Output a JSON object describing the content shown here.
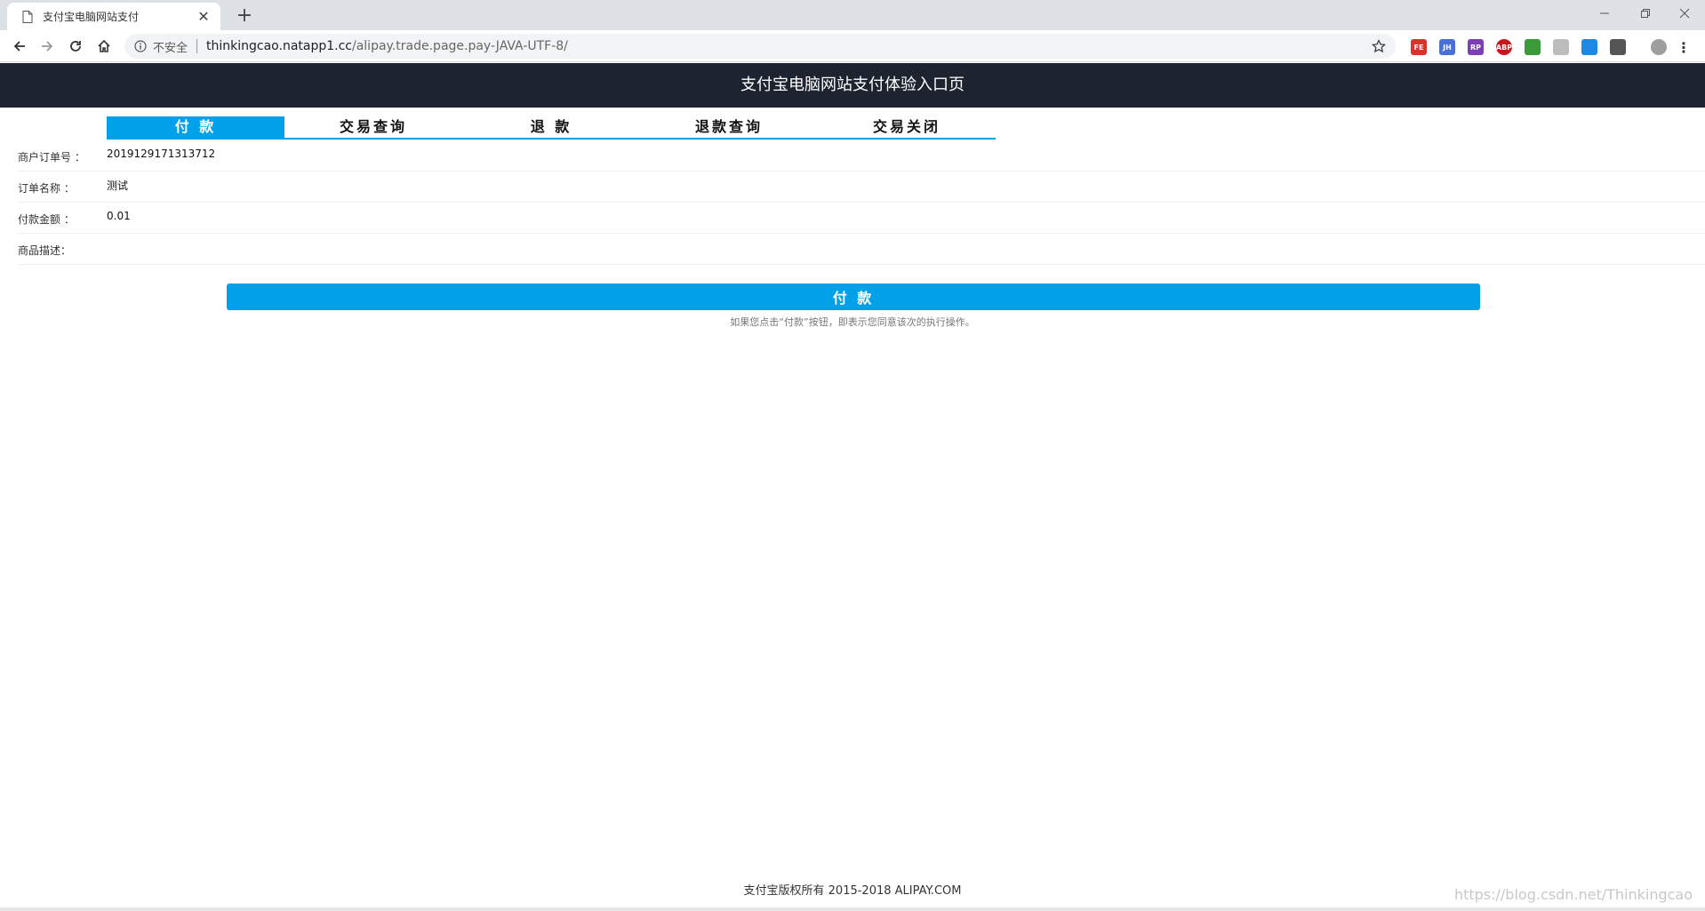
{
  "browser": {
    "tab_title": "支付宝电脑网站支付",
    "security_label": "不安全",
    "url_host": "thinkingcao.natapp1.cc",
    "url_path": "/alipay.trade.page.pay-JAVA-UTF-8/",
    "extensions": [
      {
        "icon": "fe-extension-icon",
        "label": "FE",
        "color": "#d9342b"
      },
      {
        "icon": "jh-extension-icon",
        "label": "JH",
        "color": "#4a6fd6"
      },
      {
        "icon": "rp-extension-icon",
        "label": "RP",
        "color": "#7b3fb5"
      },
      {
        "icon": "adblock-plus-icon",
        "label": "ABP",
        "color": "#c4161c"
      },
      {
        "icon": "google-extension-icon",
        "label": "",
        "color": "#3b9b3b"
      },
      {
        "icon": "download-extension-icon",
        "label": "",
        "color": "#bdbdbd"
      },
      {
        "icon": "search-extension-icon",
        "label": "",
        "color": "#1e88e5"
      },
      {
        "icon": "recycle-extension-icon",
        "label": "",
        "color": "#555555"
      }
    ]
  },
  "header": {
    "title": "支付宝电脑网站支付体验入口页"
  },
  "nav_tabs": [
    {
      "label": "付 款",
      "active": true
    },
    {
      "label": "交易查询",
      "active": false
    },
    {
      "label": "退 款",
      "active": false
    },
    {
      "label": "退款查询",
      "active": false
    },
    {
      "label": "交易关闭",
      "active": false
    }
  ],
  "form": {
    "order_no": {
      "label": "商户订单号 ：",
      "value": "2019129171313712"
    },
    "order_name": {
      "label": "订单名称 ：",
      "value": "测试"
    },
    "amount": {
      "label": "付款金额 ：",
      "value": "0.01"
    },
    "description": {
      "label": "商品描述：",
      "value": ""
    }
  },
  "pay": {
    "button_label": "付 款",
    "note": "如果您点击“付款”按钮，即表示您同意该次的执行操作。"
  },
  "footer": {
    "copyright": "支付宝版权所有 2015-2018 ALIPAY.COM"
  },
  "watermark": "https://blog.csdn.net/Thinkingcao",
  "colors": {
    "accent": "#00a1e9",
    "header_bg": "#1e2330"
  }
}
